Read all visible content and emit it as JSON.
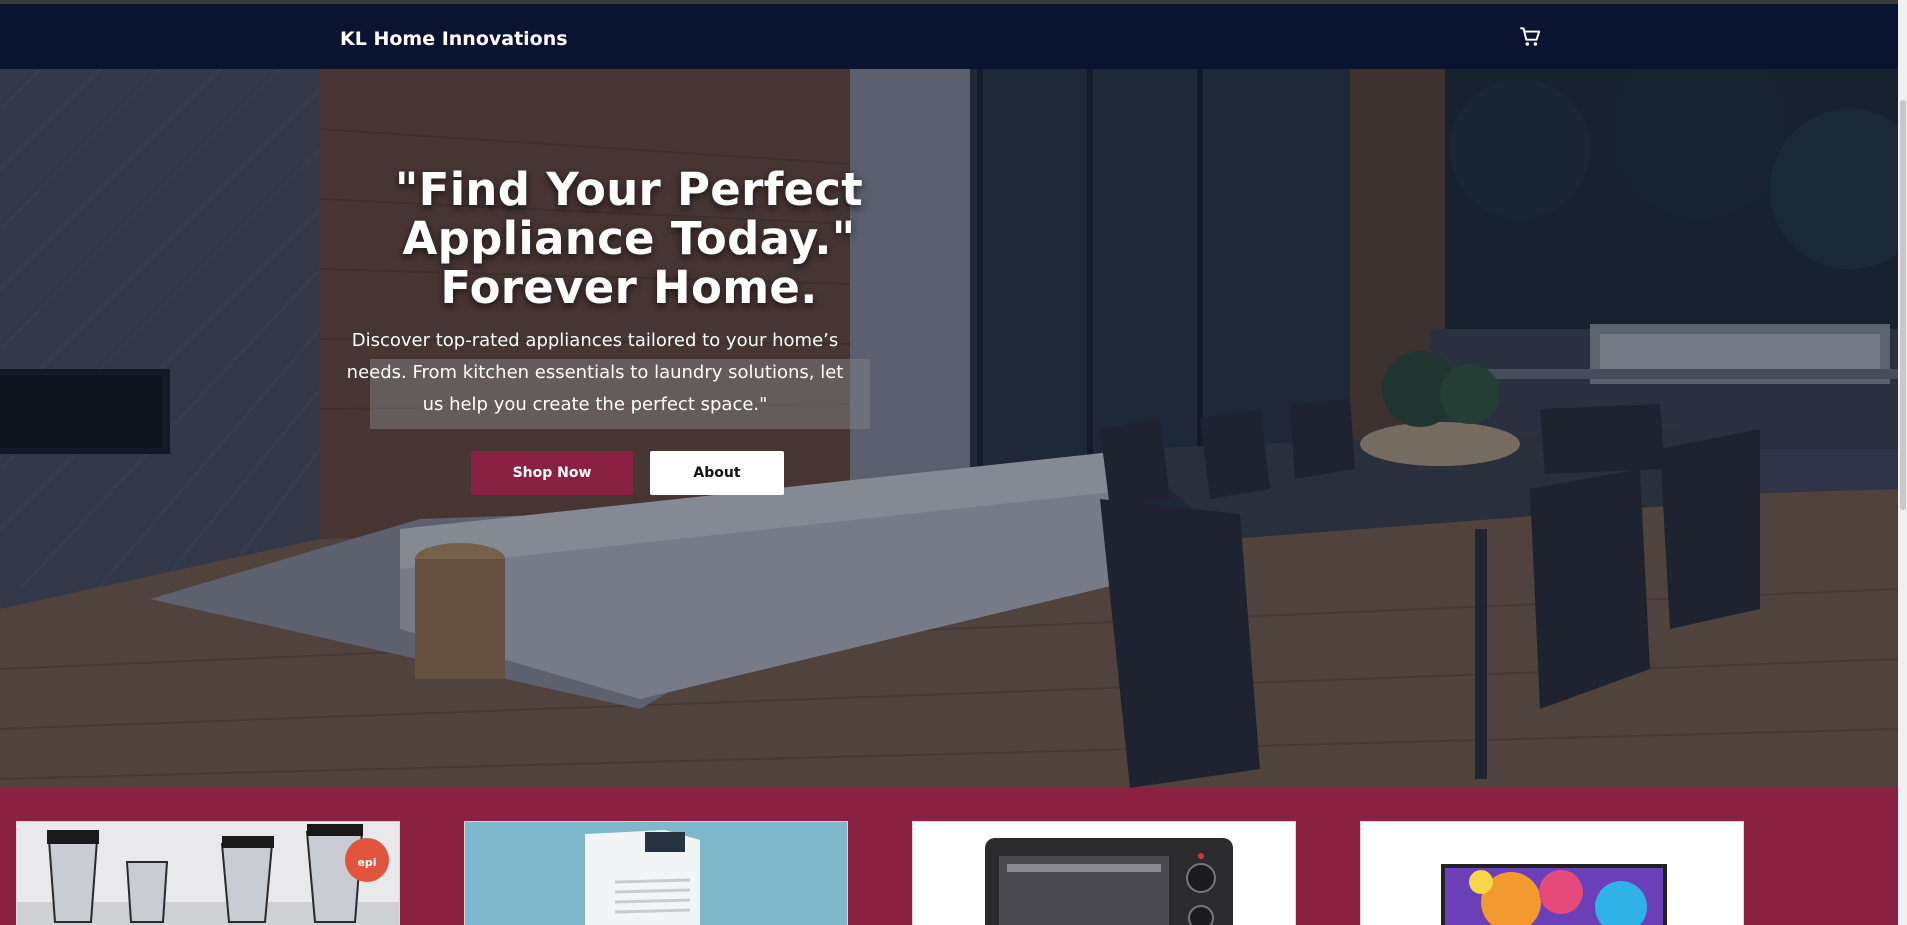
{
  "header": {
    "brand": "KL Home Innovations",
    "cart_icon": "cart-icon"
  },
  "hero": {
    "title_line1": "\"Find Your Perfect",
    "title_line2": "Appliance Today.\"",
    "title_line3": "Forever Home.",
    "subtitle": "Discover top-rated appliances tailored to your home’s needs. From kitchen essentials to laundry solutions, let us help you create the perfect space.\"",
    "shop_button": "Shop Now",
    "about_button": "About"
  },
  "products": {
    "items": [
      {
        "name": "blender-set-image"
      },
      {
        "name": "portable-air-conditioner-image"
      },
      {
        "name": "toaster-oven-image"
      },
      {
        "name": "television-image"
      }
    ]
  },
  "colors": {
    "navbar": "#0a1430",
    "accent": "#8a2142",
    "white": "#ffffff"
  }
}
